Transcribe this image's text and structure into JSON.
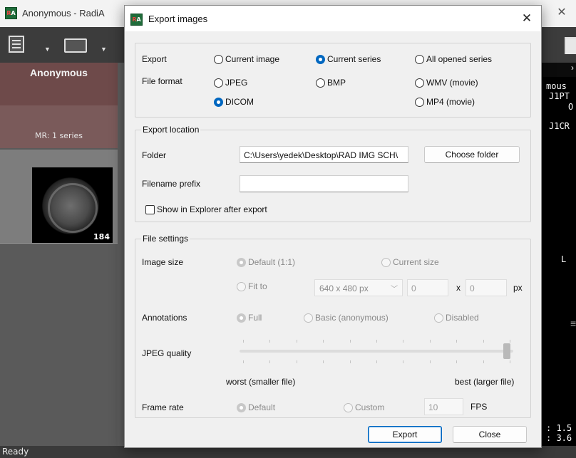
{
  "app": {
    "title": "Anonymous - RadiA",
    "logo": "RA",
    "patient_name": "Anonymous",
    "series_label": "MR: 1 series",
    "thumbnail_count": "184",
    "viewer_tab_symbol": "›",
    "viewer_lines": [
      "mous",
      "J1PT",
      "O",
      "J1CR"
    ],
    "orientation_marker": "L",
    "zoom_lines": [
      ": 1.5",
      ": 3.6"
    ],
    "status": "Ready"
  },
  "dialog": {
    "title": "Export images",
    "close_symbol": "✕",
    "export_row_label": "Export",
    "export_options": [
      {
        "label": "Current image",
        "selected": false
      },
      {
        "label": "Current series",
        "selected": true
      },
      {
        "label": "All opened series",
        "selected": false
      }
    ],
    "file_format_label": "File format",
    "file_formats": [
      {
        "label": "JPEG",
        "selected": false
      },
      {
        "label": "BMP",
        "selected": false
      },
      {
        "label": "WMV (movie)",
        "selected": false
      },
      {
        "label": "DICOM",
        "selected": true
      },
      {
        "label": "MP4 (movie)",
        "selected": false
      }
    ],
    "location": {
      "title": "Export location",
      "folder_label": "Folder",
      "folder_value": "C:\\Users\\yedek\\Desktop\\RAD IMG SCH\\",
      "choose_folder": "Choose folder",
      "prefix_label": "Filename prefix",
      "prefix_value": "",
      "show_in_explorer": "Show in Explorer after export",
      "show_in_explorer_checked": false
    },
    "settings": {
      "title": "File settings",
      "image_size_label": "Image size",
      "size_default": "Default (1:1)",
      "size_current": "Current size",
      "size_fit": "Fit to",
      "fit_preset": "640 x 480 px",
      "width_value": "0",
      "x_label": "x",
      "height_value": "0",
      "px_label": "px",
      "annotations_label": "Annotations",
      "ann_full": "Full",
      "ann_basic": "Basic (anonymous)",
      "ann_disabled": "Disabled",
      "jpeg_quality_label": "JPEG quality",
      "jpeg_quality_level": 1.0,
      "quality_min_label": "worst (smaller file)",
      "quality_max_label": "best (larger file)",
      "frame_rate_label": "Frame rate",
      "fr_default": "Default",
      "fr_custom": "Custom",
      "fps_value": "10",
      "fps_label": "FPS"
    },
    "export_button": "Export",
    "close_button": "Close"
  }
}
